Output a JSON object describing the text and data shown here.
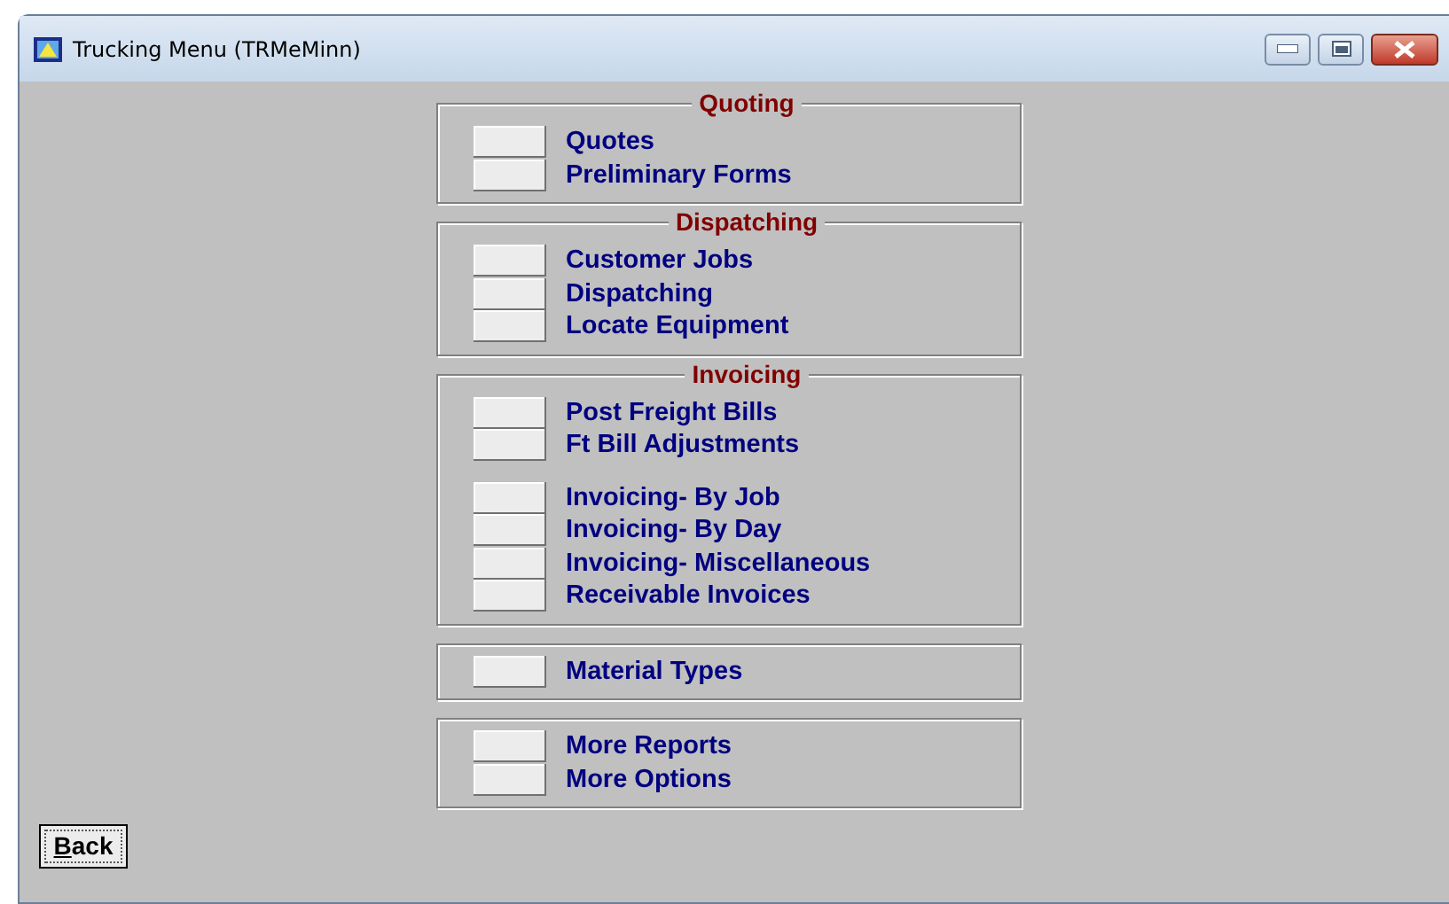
{
  "window": {
    "title": "Trucking Menu (TRMeMinn)"
  },
  "groups": [
    {
      "title": "Quoting",
      "items": [
        {
          "label": "Quotes",
          "spaced": false
        },
        {
          "label": "Preliminary Forms",
          "spaced": false
        }
      ]
    },
    {
      "title": "Dispatching",
      "items": [
        {
          "label": "Customer Jobs",
          "spaced": false
        },
        {
          "label": "Dispatching",
          "spaced": false
        },
        {
          "label": "Locate Equipment",
          "spaced": false
        }
      ]
    },
    {
      "title": "Invoicing",
      "items": [
        {
          "label": "Post Freight Bills",
          "spaced": false
        },
        {
          "label": "Ft Bill Adjustments",
          "spaced": false
        },
        {
          "label": "Invoicing- By Job",
          "spaced": true
        },
        {
          "label": "Invoicing- By Day",
          "spaced": false
        },
        {
          "label": "Invoicing- Miscellaneous",
          "spaced": false
        },
        {
          "label": "Receivable Invoices",
          "spaced": false
        }
      ]
    },
    {
      "items": [
        {
          "label": "Material Types",
          "spaced": false
        }
      ]
    },
    {
      "items": [
        {
          "label": "More Reports",
          "spaced": false
        },
        {
          "label": "More Options",
          "spaced": false
        }
      ]
    }
  ],
  "back_button": {
    "label": "Back",
    "underline_first": true
  }
}
